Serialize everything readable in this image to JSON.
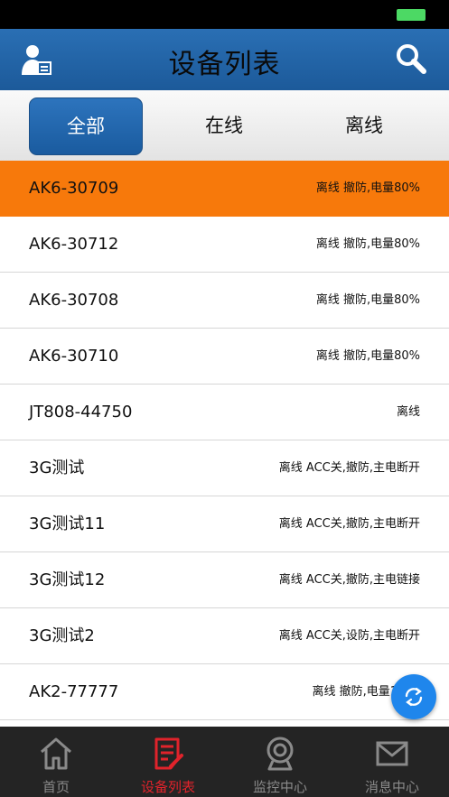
{
  "header": {
    "title": "设备列表"
  },
  "segments": [
    {
      "label": "全部"
    },
    {
      "label": "在线"
    },
    {
      "label": "离线"
    }
  ],
  "devices": [
    {
      "name": "AK6-30709",
      "status": "离线 撤防,电量80%"
    },
    {
      "name": "AK6-30712",
      "status": "离线 撤防,电量80%"
    },
    {
      "name": "AK6-30708",
      "status": "离线 撤防,电量80%"
    },
    {
      "name": "AK6-30710",
      "status": "离线 撤防,电量80%"
    },
    {
      "name": "JT808-44750",
      "status": "离线"
    },
    {
      "name": "3G测试",
      "status": "离线 ACC关,撤防,主电断开"
    },
    {
      "name": "3G测试11",
      "status": "离线 ACC关,撤防,主电断开"
    },
    {
      "name": "3G测试12",
      "status": "离线 ACC关,撤防,主电链接"
    },
    {
      "name": "3G测试2",
      "status": "离线 ACC关,设防,主电断开"
    },
    {
      "name": "AK2-77777",
      "status": "离线 撤防,电量1"
    }
  ],
  "tabbar": [
    {
      "label": "首页",
      "icon": "home-icon"
    },
    {
      "label": "设备列表",
      "icon": "device-list-icon"
    },
    {
      "label": "监控中心",
      "icon": "camera-icon"
    },
    {
      "label": "消息中心",
      "icon": "mail-icon"
    }
  ],
  "colors": {
    "header": "#1f62a5",
    "highlight_row": "#f7790b",
    "active_tab": "#e0232b",
    "fab": "#1f86ec"
  }
}
